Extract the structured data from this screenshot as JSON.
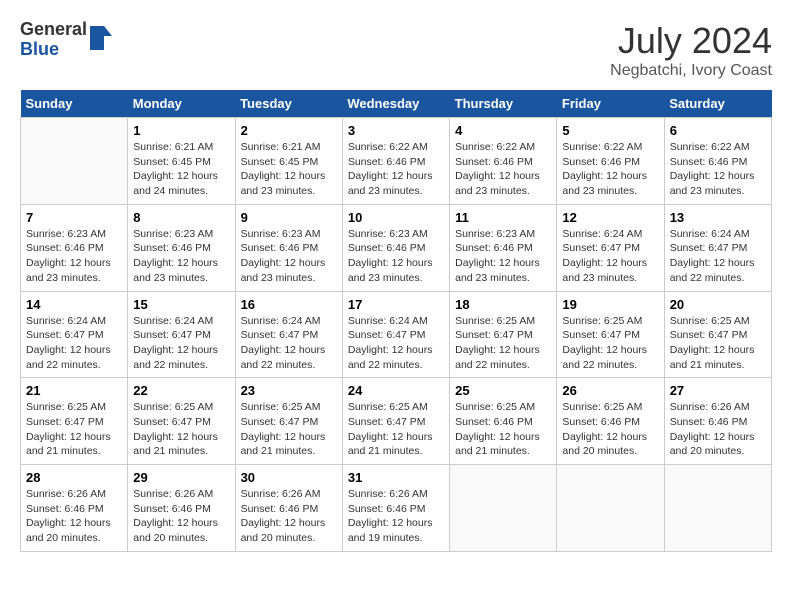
{
  "logo": {
    "general": "General",
    "blue": "Blue"
  },
  "title": "July 2024",
  "subtitle": "Negbatchi, Ivory Coast",
  "days_header": [
    "Sunday",
    "Monday",
    "Tuesday",
    "Wednesday",
    "Thursday",
    "Friday",
    "Saturday"
  ],
  "weeks": [
    [
      {
        "day": "",
        "info": ""
      },
      {
        "day": "1",
        "info": "Sunrise: 6:21 AM\nSunset: 6:45 PM\nDaylight: 12 hours\nand 24 minutes."
      },
      {
        "day": "2",
        "info": "Sunrise: 6:21 AM\nSunset: 6:45 PM\nDaylight: 12 hours\nand 23 minutes."
      },
      {
        "day": "3",
        "info": "Sunrise: 6:22 AM\nSunset: 6:46 PM\nDaylight: 12 hours\nand 23 minutes."
      },
      {
        "day": "4",
        "info": "Sunrise: 6:22 AM\nSunset: 6:46 PM\nDaylight: 12 hours\nand 23 minutes."
      },
      {
        "day": "5",
        "info": "Sunrise: 6:22 AM\nSunset: 6:46 PM\nDaylight: 12 hours\nand 23 minutes."
      },
      {
        "day": "6",
        "info": "Sunrise: 6:22 AM\nSunset: 6:46 PM\nDaylight: 12 hours\nand 23 minutes."
      }
    ],
    [
      {
        "day": "7",
        "info": "Sunrise: 6:23 AM\nSunset: 6:46 PM\nDaylight: 12 hours\nand 23 minutes."
      },
      {
        "day": "8",
        "info": "Sunrise: 6:23 AM\nSunset: 6:46 PM\nDaylight: 12 hours\nand 23 minutes."
      },
      {
        "day": "9",
        "info": "Sunrise: 6:23 AM\nSunset: 6:46 PM\nDaylight: 12 hours\nand 23 minutes."
      },
      {
        "day": "10",
        "info": "Sunrise: 6:23 AM\nSunset: 6:46 PM\nDaylight: 12 hours\nand 23 minutes."
      },
      {
        "day": "11",
        "info": "Sunrise: 6:23 AM\nSunset: 6:46 PM\nDaylight: 12 hours\nand 23 minutes."
      },
      {
        "day": "12",
        "info": "Sunrise: 6:24 AM\nSunset: 6:47 PM\nDaylight: 12 hours\nand 23 minutes."
      },
      {
        "day": "13",
        "info": "Sunrise: 6:24 AM\nSunset: 6:47 PM\nDaylight: 12 hours\nand 22 minutes."
      }
    ],
    [
      {
        "day": "14",
        "info": "Sunrise: 6:24 AM\nSunset: 6:47 PM\nDaylight: 12 hours\nand 22 minutes."
      },
      {
        "day": "15",
        "info": "Sunrise: 6:24 AM\nSunset: 6:47 PM\nDaylight: 12 hours\nand 22 minutes."
      },
      {
        "day": "16",
        "info": "Sunrise: 6:24 AM\nSunset: 6:47 PM\nDaylight: 12 hours\nand 22 minutes."
      },
      {
        "day": "17",
        "info": "Sunrise: 6:24 AM\nSunset: 6:47 PM\nDaylight: 12 hours\nand 22 minutes."
      },
      {
        "day": "18",
        "info": "Sunrise: 6:25 AM\nSunset: 6:47 PM\nDaylight: 12 hours\nand 22 minutes."
      },
      {
        "day": "19",
        "info": "Sunrise: 6:25 AM\nSunset: 6:47 PM\nDaylight: 12 hours\nand 22 minutes."
      },
      {
        "day": "20",
        "info": "Sunrise: 6:25 AM\nSunset: 6:47 PM\nDaylight: 12 hours\nand 21 minutes."
      }
    ],
    [
      {
        "day": "21",
        "info": "Sunrise: 6:25 AM\nSunset: 6:47 PM\nDaylight: 12 hours\nand 21 minutes."
      },
      {
        "day": "22",
        "info": "Sunrise: 6:25 AM\nSunset: 6:47 PM\nDaylight: 12 hours\nand 21 minutes."
      },
      {
        "day": "23",
        "info": "Sunrise: 6:25 AM\nSunset: 6:47 PM\nDaylight: 12 hours\nand 21 minutes."
      },
      {
        "day": "24",
        "info": "Sunrise: 6:25 AM\nSunset: 6:47 PM\nDaylight: 12 hours\nand 21 minutes."
      },
      {
        "day": "25",
        "info": "Sunrise: 6:25 AM\nSunset: 6:46 PM\nDaylight: 12 hours\nand 21 minutes."
      },
      {
        "day": "26",
        "info": "Sunrise: 6:25 AM\nSunset: 6:46 PM\nDaylight: 12 hours\nand 20 minutes."
      },
      {
        "day": "27",
        "info": "Sunrise: 6:26 AM\nSunset: 6:46 PM\nDaylight: 12 hours\nand 20 minutes."
      }
    ],
    [
      {
        "day": "28",
        "info": "Sunrise: 6:26 AM\nSunset: 6:46 PM\nDaylight: 12 hours\nand 20 minutes."
      },
      {
        "day": "29",
        "info": "Sunrise: 6:26 AM\nSunset: 6:46 PM\nDaylight: 12 hours\nand 20 minutes."
      },
      {
        "day": "30",
        "info": "Sunrise: 6:26 AM\nSunset: 6:46 PM\nDaylight: 12 hours\nand 20 minutes."
      },
      {
        "day": "31",
        "info": "Sunrise: 6:26 AM\nSunset: 6:46 PM\nDaylight: 12 hours\nand 19 minutes."
      },
      {
        "day": "",
        "info": ""
      },
      {
        "day": "",
        "info": ""
      },
      {
        "day": "",
        "info": ""
      }
    ]
  ]
}
